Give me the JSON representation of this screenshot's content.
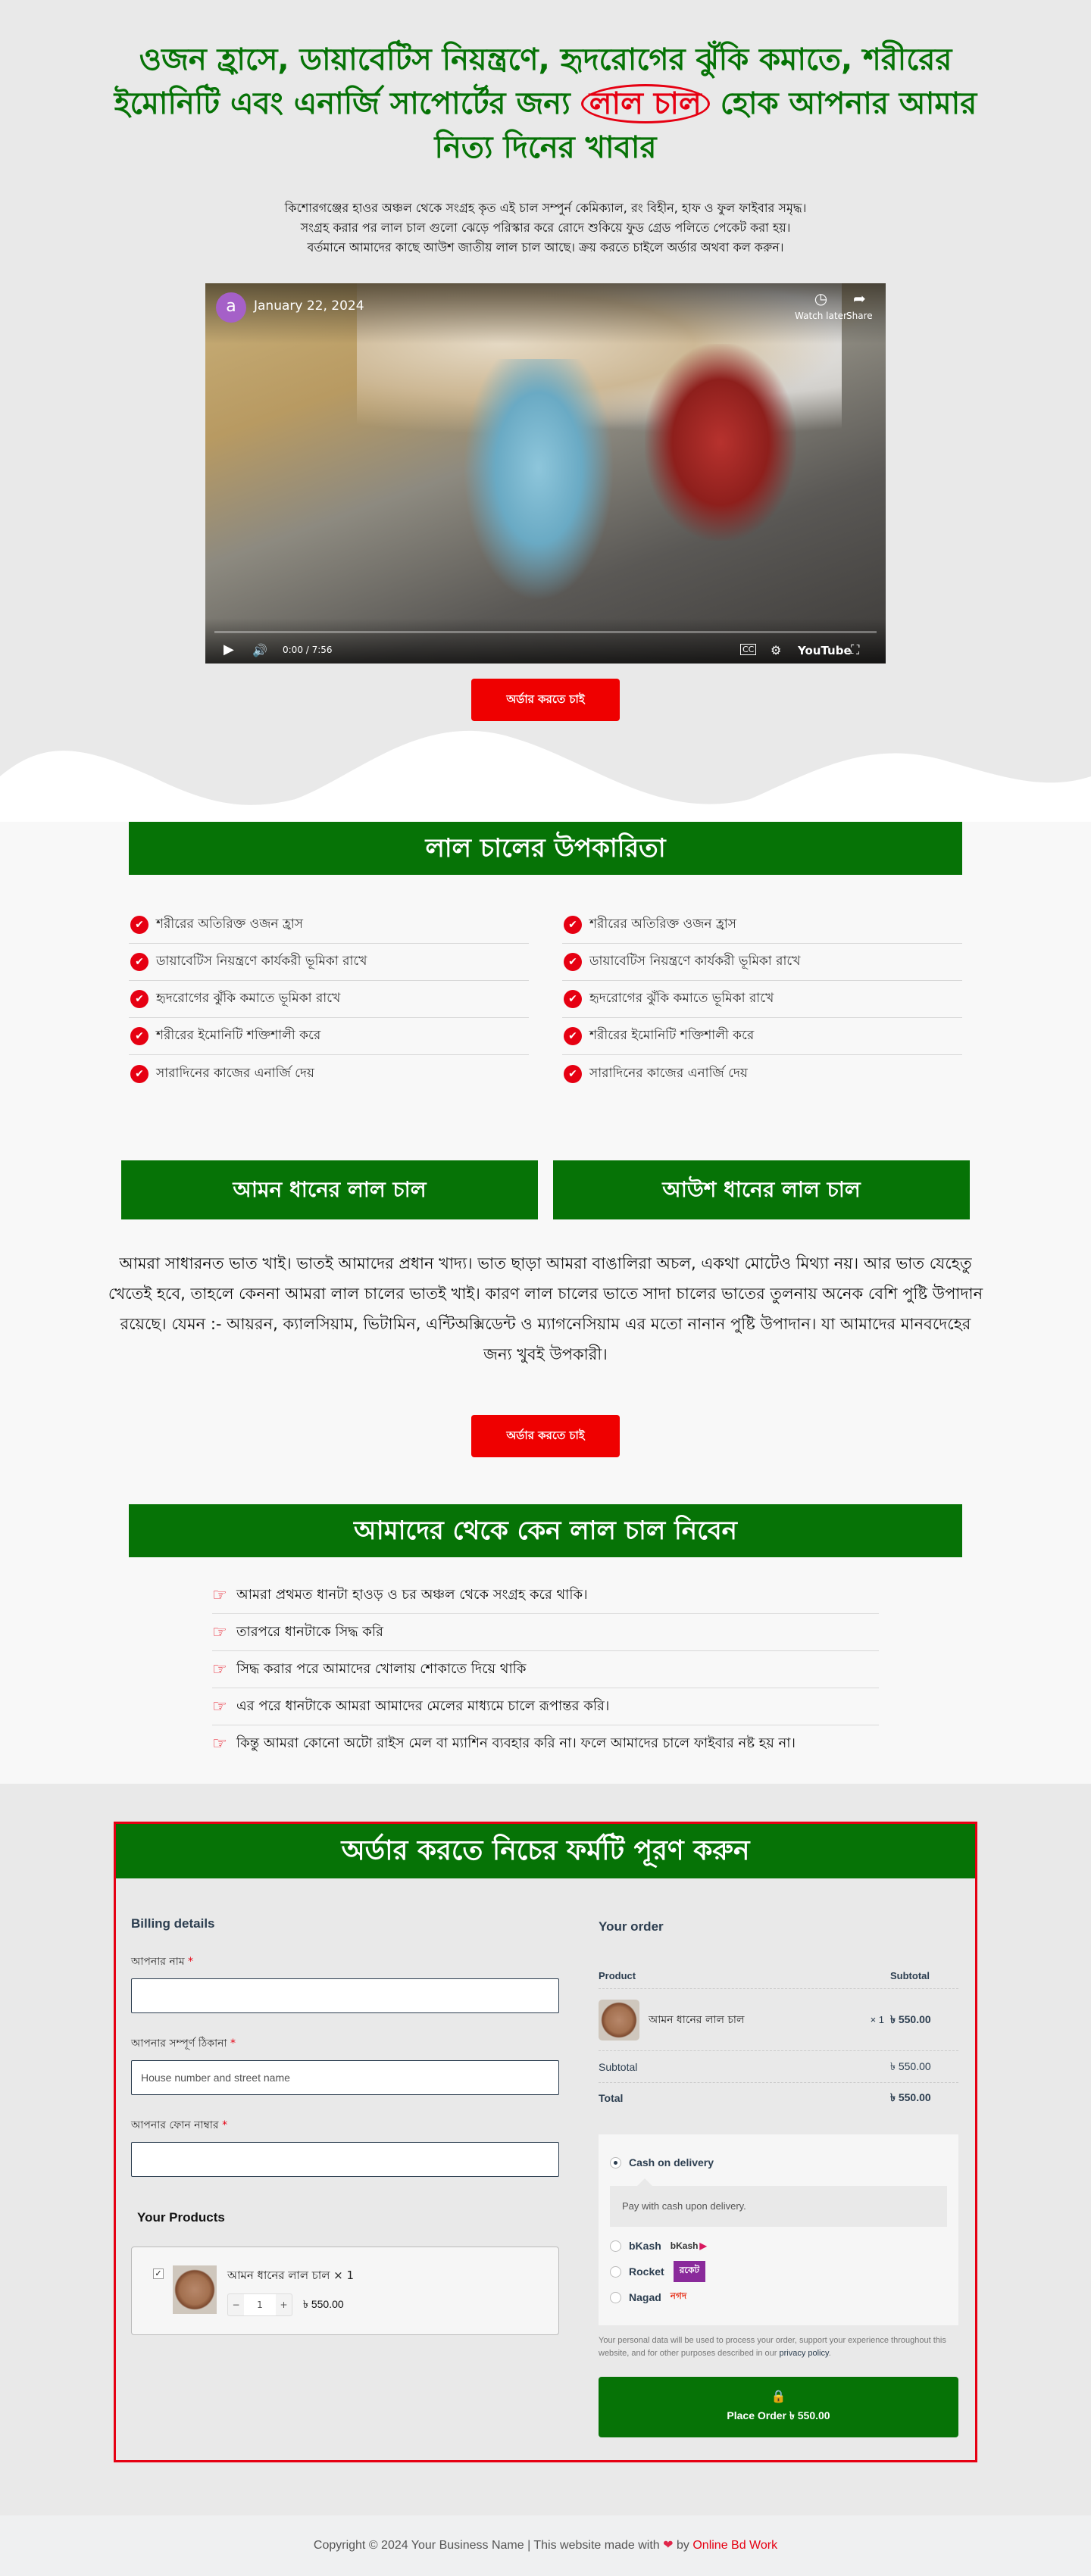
{
  "hero": {
    "title_part1": "ওজন হ্রাসে, ডায়াবেটিস নিয়ন্ত্রণে, হৃদরোগের ঝুঁকি কমাতে, শরীরের ইমোনিটি এবং এনার্জি সাপোর্টের জন্য",
    "title_highlight": "লাল চাল",
    "title_part2": "হোক আপনার আমার নিত্য দিনের খাবার",
    "description": "কিশোরগঞ্জের হাওর অঞ্চল থেকে সংগ্রহ কৃত এই চাল সম্পুর্ন কেমিক্যাল, রং বিহীন, হাফ ও ফুল ফাইবার সমৃদ্ধ। সংগ্রহ করার পর লাল চাল গুলো ঝেড়ে পরিস্কার করে রোদে শুকিয়ে ফুড গ্রেড পলিতে পেকেট করা হয়। বর্তমানে আমাদের কাছে আউশ জাতীয় লাল চাল আছে। ক্রয় করতে চাইলে অর্ডার অথবা কল করুন।",
    "cta_label": "অর্ডার করতে চাই"
  },
  "video": {
    "channel_initial": "a",
    "date": "January 22, 2024",
    "watch_later": "Watch later",
    "share": "Share",
    "time": "0:00 / 7:56",
    "progress": 0,
    "brand": "YouTube",
    "icons": [
      "clock-icon",
      "share-icon",
      "play-icon",
      "volume-icon",
      "captions-icon",
      "settings-icon",
      "fullscreen-icon"
    ]
  },
  "benefits": {
    "title": "লাল চালের উপকারিতা",
    "left": [
      "শরীরের অতিরিক্ত ওজন হ্রাস",
      "ডায়াবেটিস নিয়ন্ত্রণে কার্যকরী ভূমিকা রাখে",
      "হৃদরোগের ঝুঁকি কমাতে ভূমিকা রাখে",
      "শরীরের ইমোনিটি শক্তিশালী করে",
      "সারাদিনের কাজের এনার্জি দেয়"
    ],
    "right": [
      "শরীরের অতিরিক্ত ওজন হ্রাস",
      "ডায়াবেটিস নিয়ন্ত্রণে কার্যকরী ভূমিকা রাখে",
      "হৃদরোগের ঝুঁকি কমাতে ভূমিকা রাখে",
      "শরীরের ইমোনিটি শক্তিশালী করে",
      "সারাদিনের কাজের এনার্জি দেয়"
    ]
  },
  "varieties": [
    "আমন ধানের লাল চাল",
    "আউশ ধানের লাল চাল"
  ],
  "about": "আমরা সাধারনত ভাত খাই। ভাতই আমাদের প্রধান খাদ্য। ভাত ছাড়া আমরা বাঙালিরা অচল, একথা মোটেও মিথ্যা নয়। আর ভাত যেহেতু খেতেই হবে, তাহলে কেননা আমরা লাল চালের ভাতই খাই। কারণ লাল চালের ভাতে সাদা চালের ভাতের তুলনায় অনেক বেশি পুষ্টি উপাদান রয়েছে। যেমন :- আয়রন, ক্যালসিয়াম, ভিটামিন, এন্টিঅক্সিডেন্ট ও ম্যাগনেসিয়াম এর মতো নানান পুষ্টি উপাদান। যা আমাদের মানবদেহের জন্য খুবই উপকারী।",
  "cta2_label": "অর্ডার করতে চাই",
  "why": {
    "title": "আমাদের থেকে কেন লাল চাল নিবেন",
    "items": [
      "আমরা প্রথমত ধানটা হাওড় ও চর অঞ্চল থেকে সংগ্রহ করে থাকি।",
      "তারপরে ধানটাকে সিদ্ধ করি",
      "সিদ্ধ করার পরে আমাদের খোলায় শোকাতে দিয়ে থাকি",
      "এর পরে ধানটাকে আমরা আমাদের মেলের মাধ্যমে চালে রূপান্তর করি।",
      "কিন্তু আমরা কোনো অটো রাইস মেল বা ম্যাশিন ব্যবহার করি না। ফলে আমাদের চালে ফাইবার নষ্ট হয় না।"
    ]
  },
  "order": {
    "title": "অর্ডার করতে নিচের ফর্মটি পূরণ করুন",
    "billing": {
      "heading": "Billing details",
      "fields": [
        {
          "label": "আপনার নাম",
          "required": "*",
          "value": "",
          "placeholder": ""
        },
        {
          "label": "আপনার সম্পূর্ণ ঠিকানা",
          "required": "*",
          "value": "",
          "placeholder": "House number and street name"
        },
        {
          "label": "আপনার ফোন নাম্বার",
          "required": "*",
          "value": "",
          "placeholder": ""
        }
      ]
    },
    "products": {
      "heading": "Your Products",
      "item": {
        "checked": "✓",
        "name": "আমন ধানের লাল চাল × 1",
        "qty": "1",
        "minus": "−",
        "plus": "+",
        "price": "৳ 550.00"
      }
    },
    "summary": {
      "heading": "Your order",
      "col_product": "Product",
      "col_subtotal": "Subtotal",
      "item_name": "আমন ধানের লাল চাল",
      "item_qty": "× 1",
      "item_price": "৳ 550.00",
      "subtotal_label": "Subtotal",
      "subtotal_value": "৳ 550.00",
      "total_label": "Total",
      "total_value": "৳ 550.00"
    },
    "payment": {
      "options": [
        {
          "label": "Cash on delivery",
          "selected": true,
          "logo": ""
        },
        {
          "label": "bKash",
          "selected": false,
          "logo": "bKash"
        },
        {
          "label": "Rocket",
          "selected": false,
          "logo": "রকেট"
        },
        {
          "label": "Nagad",
          "selected": false,
          "logo": "নগদ"
        }
      ],
      "cod_description": "Pay with cash upon delivery."
    },
    "privacy_text": "Your personal data will be used to process your order, support your experience throughout this website, and for other purposes described in our",
    "privacy_link": "privacy policy",
    "privacy_end": ".",
    "place_order": "Place Order  ৳ 550.00"
  },
  "footer": {
    "text": "Copyright © 2024 Your Business Name | This website made with",
    "by": "by",
    "link": "Online Bd Work"
  },
  "colors": {
    "green": "#067306",
    "red": "#e60012",
    "cta_red": "#ef0000"
  }
}
